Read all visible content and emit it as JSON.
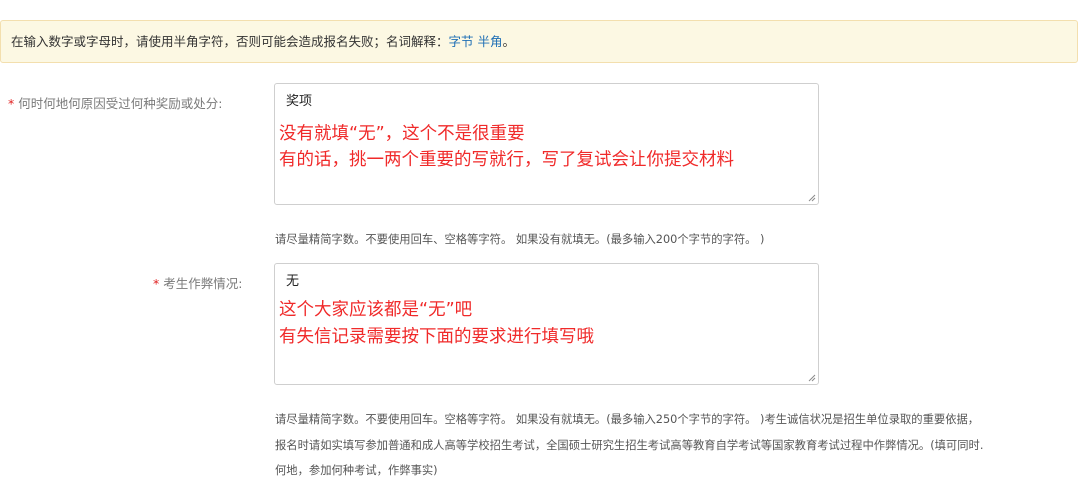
{
  "notice": {
    "text": "在输入数字或字母时，请使用半角字符，否则可能会造成报名失败；名词解释：",
    "link_byte": "字节",
    "link_halfwidth": "半角",
    "end": "。"
  },
  "fields": {
    "awards": {
      "required_mark": "*",
      "label": "何时何地何原因受过何种奖励或处分:",
      "value": "奖项",
      "annotation_line1": "没有就填“无”，这个不是很重要",
      "annotation_line2": "有的话，挑一两个重要的写就行，写了复试会让你提交材料",
      "help": "请尽量精简字数。不要使用回车、空格等字符。 如果没有就填无。(最多输入200个字节的字符。 )"
    },
    "cheating": {
      "required_mark": "*",
      "label": "考生作弊情况:",
      "value": "无",
      "annotation_line1": "这个大家应该都是“无”吧",
      "annotation_line2": "有失信记录需要按下面的要求进行填写哦",
      "help_line1": "请尽量精简字数。不要使用回车。空格等字符。 如果没有就填无。(最多输入250个字节的字符。 )考生诚信状况是招生单位录取的重要依据，",
      "help_line2": "报名时请如实填写参加普通和成人高等学校招生考试，全国硕士研究生招生考试高等教育自学考试等国家教育考试过程中作弊情况。(填可同时.",
      "help_line3": "何地，参加何种考试，作弊事实)"
    }
  },
  "colors": {
    "notice_bg": "#fcf8e3",
    "link": "#1f6fb5",
    "required": "#e02020",
    "annotation": "#f02a2a"
  }
}
